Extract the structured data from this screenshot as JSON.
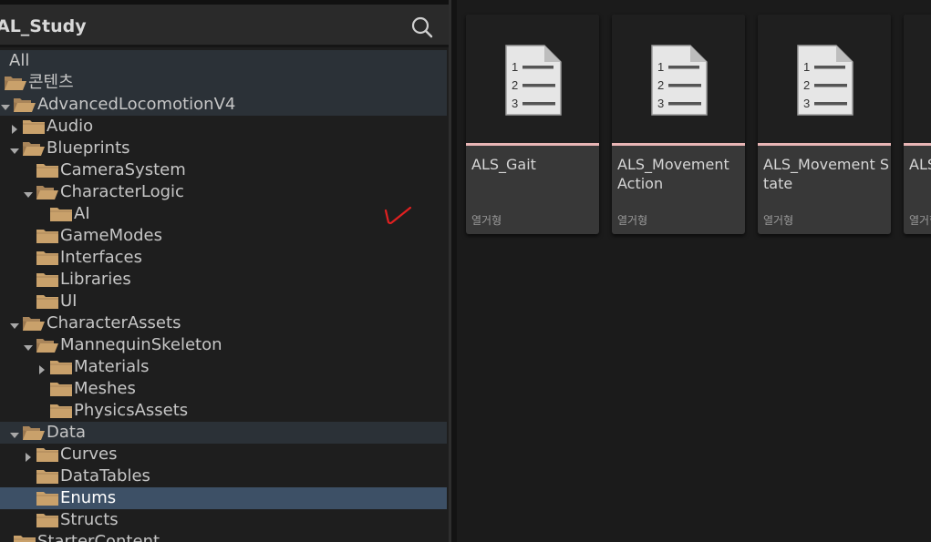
{
  "panel": {
    "title": "AL_Study",
    "search_icon": "search-icon"
  },
  "tree": [
    {
      "label": "All",
      "arrow": "none",
      "folder": "none",
      "state": "highlight"
    },
    {
      "label": "콘텐츠",
      "arrow": "none",
      "folder": "open",
      "state": "highlight"
    },
    {
      "label": "AdvancedLocomotionV4",
      "arrow": "down",
      "folder": "open",
      "state": "highlight"
    },
    {
      "label": "Audio",
      "arrow": "right",
      "folder": "closed",
      "state": "normal"
    },
    {
      "label": "Blueprints",
      "arrow": "down",
      "folder": "open",
      "state": "normal"
    },
    {
      "label": "CameraSystem",
      "arrow": "none",
      "folder": "closed",
      "state": "normal"
    },
    {
      "label": "CharacterLogic",
      "arrow": "down",
      "folder": "open",
      "state": "normal"
    },
    {
      "label": "AI",
      "arrow": "none",
      "folder": "closed",
      "state": "normal"
    },
    {
      "label": "GameModes",
      "arrow": "none",
      "folder": "closed",
      "state": "normal"
    },
    {
      "label": "Interfaces",
      "arrow": "none",
      "folder": "closed",
      "state": "normal"
    },
    {
      "label": "Libraries",
      "arrow": "none",
      "folder": "closed",
      "state": "normal"
    },
    {
      "label": "UI",
      "arrow": "none",
      "folder": "closed",
      "state": "normal"
    },
    {
      "label": "CharacterAssets",
      "arrow": "down",
      "folder": "open",
      "state": "normal"
    },
    {
      "label": "MannequinSkeleton",
      "arrow": "down",
      "folder": "open",
      "state": "normal"
    },
    {
      "label": "Materials",
      "arrow": "right",
      "folder": "closed",
      "state": "normal"
    },
    {
      "label": "Meshes",
      "arrow": "none",
      "folder": "closed",
      "state": "normal"
    },
    {
      "label": "PhysicsAssets",
      "arrow": "none",
      "folder": "closed",
      "state": "normal"
    },
    {
      "label": "Data",
      "arrow": "down",
      "folder": "open",
      "state": "highlight"
    },
    {
      "label": "Curves",
      "arrow": "right",
      "folder": "closed",
      "state": "normal"
    },
    {
      "label": "DataTables",
      "arrow": "none",
      "folder": "closed",
      "state": "normal"
    },
    {
      "label": "Enums",
      "arrow": "none",
      "folder": "closed",
      "state": "selected"
    },
    {
      "label": "Structs",
      "arrow": "none",
      "folder": "closed",
      "state": "normal"
    },
    {
      "label": "StarterContent",
      "arrow": "none",
      "folder": "closed",
      "state": "normal"
    }
  ],
  "assets": [
    {
      "name": "ALS_Gait",
      "type": "열거형",
      "icon": "enum-document-icon"
    },
    {
      "name": "ALS_Movement Action",
      "type": "열거형",
      "icon": "enum-document-icon"
    },
    {
      "name": "ALS_Movement State",
      "type": "열거형",
      "icon": "enum-document-icon"
    },
    {
      "name": "ALS_Stance",
      "type": "열거형",
      "icon": "enum-document-icon"
    }
  ],
  "annotation": {
    "checkmark_icon": "red-checkmark-icon",
    "checkmark_color": "#e02020"
  },
  "colors": {
    "folder": "#c9a16b",
    "selection": "#3d5066",
    "highlight": "#2b3137",
    "card_accent": "#e8b5b5"
  }
}
